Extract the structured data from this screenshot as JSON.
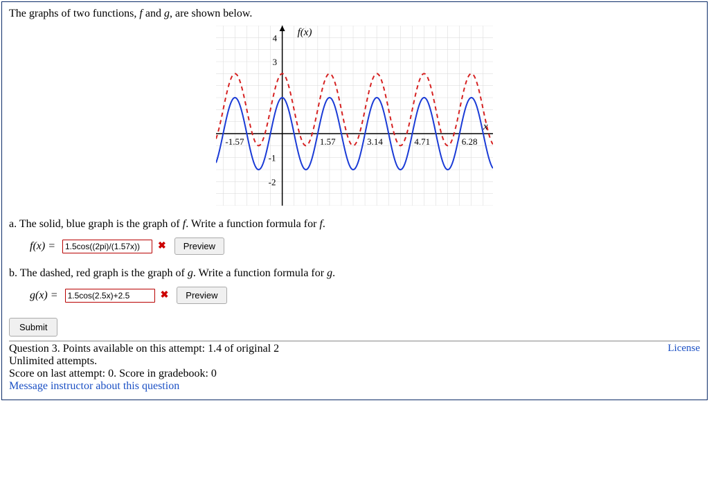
{
  "intro_prefix": "The graphs of two functions, ",
  "intro_mid": " and ",
  "intro_suffix": ", are shown below.",
  "f_name": "f",
  "g_name": "g",
  "part_a_prefix": "a. The solid, blue graph is the graph of ",
  "part_a_suffix": ". Write a function formula for ",
  "part_a_end": ".",
  "part_b_prefix": "b. The dashed, red graph is the graph of ",
  "part_b_suffix": ". Write a function formula for ",
  "part_b_end": ".",
  "label_fx": "f(x) = ",
  "label_gx": "g(x) = ",
  "answer_a": "1.5cos((2pi)/(1.57x))",
  "answer_b": "1.5cos(2.5x)+2.5",
  "wrong_mark": "✖",
  "preview_btn": "Preview",
  "submit_btn": "Submit",
  "footer_line1": "Question 3. Points available on this attempt: 1.4 of original 2",
  "footer_line2": "Unlimited attempts.",
  "footer_line3": "Score on last attempt: 0. Score in gradebook: 0",
  "footer_msg": "Message instructor about this question",
  "license": "License",
  "chart_data": {
    "type": "line",
    "title": "",
    "xlabel": "x",
    "ylabel": "f(x)",
    "xlim": [
      -2.2,
      7.0
    ],
    "ylim": [
      -3,
      4.5
    ],
    "x_ticks": [
      -1.57,
      1.57,
      3.14,
      4.71,
      6.28
    ],
    "y_ticks": [
      -2,
      -1,
      3,
      4
    ],
    "series": [
      {
        "name": "f (solid blue)",
        "color": "#1a3bd6",
        "style": "solid",
        "formula": "1.5*cos(4*x)",
        "amplitude": 1.5,
        "midline": 0,
        "period": 1.5708
      },
      {
        "name": "g (dashed red)",
        "color": "#d62222",
        "style": "dashed",
        "formula": "1.5*cos(4*x)+1",
        "amplitude": 1.5,
        "midline": 1,
        "period": 1.5708
      }
    ]
  }
}
